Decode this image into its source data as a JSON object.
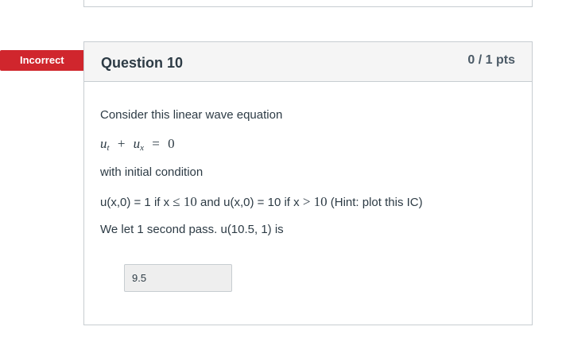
{
  "status": {
    "label": "Incorrect",
    "color": "#d0262d"
  },
  "question": {
    "title": "Question 10",
    "points": "0 / 1 pts",
    "intro": "Consider this linear wave equation",
    "equation": {
      "var1": "u",
      "sub1": "t",
      "plus": "+",
      "var2": "u",
      "sub2": "x",
      "equals": "=",
      "rhs": "0"
    },
    "ic_label": "with initial condition",
    "condition": {
      "part1": "u(x,0) = 1 if x ",
      "leq": "≤",
      "value1": "10",
      "part2": " and u(x,0) = 10 if x ",
      "gt": ">",
      "value2": "10",
      "hint": " (Hint: plot this IC)"
    },
    "prompt": "We let 1 second pass. u(10.5, 1) is",
    "answer": "9.5"
  }
}
